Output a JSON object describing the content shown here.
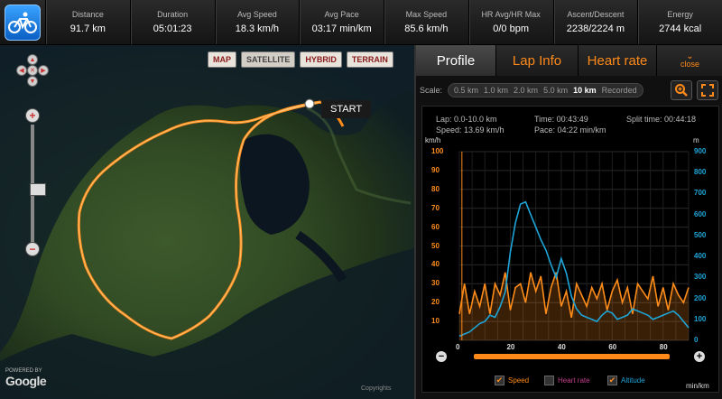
{
  "stats": [
    {
      "label": "Distance",
      "value": "91.7 km"
    },
    {
      "label": "Duration",
      "value": "05:01:23"
    },
    {
      "label": "Avg Speed",
      "value": "18.3 km/h"
    },
    {
      "label": "Avg Pace",
      "value": "03:17 min/km"
    },
    {
      "label": "Max Speed",
      "value": "85.6 km/h"
    },
    {
      "label": "HR Avg/HR Max",
      "value": "0/0 bpm"
    },
    {
      "label": "Ascent/Descent",
      "value": "2238/2224 m"
    },
    {
      "label": "Energy",
      "value": "2744 kcal"
    }
  ],
  "activity_icon": "bicycle-icon",
  "map": {
    "types": [
      "MAP",
      "SATELLITE",
      "HYBRID",
      "TERRAIN"
    ],
    "active_type": "SATELLITE",
    "start_label": "START",
    "powered_by": "POWERED BY",
    "google": "Google",
    "attribution": "Copyrights"
  },
  "tabs": {
    "profile": "Profile",
    "lap_info": "Lap Info",
    "heart_rate": "Heart rate",
    "close": "close"
  },
  "scale": {
    "label": "Scale:",
    "options": [
      "0.5 km",
      "1.0 km",
      "2.0 km",
      "5.0 km",
      "10 km",
      "Recorded"
    ],
    "selected": "10 km"
  },
  "lap": {
    "lap": "Lap: 0.0-10.0 km",
    "speed": "Speed: 13.69 km/h",
    "time": "Time: 00:43:49",
    "pace": "Pace: 04:22 min/km",
    "split": "Split time: 00:44:18"
  },
  "colors": {
    "speed": "#ff8c1a",
    "altitude": "#1ea5d8",
    "accent": "#ff8a1a"
  },
  "legend": {
    "speed": "Speed",
    "heart_rate": "Heart rate",
    "altitude": "Altitude"
  },
  "legend_checked": {
    "speed": true,
    "heart_rate": false,
    "altitude": true
  },
  "chart_data": {
    "type": "line",
    "left_unit": "km/h",
    "right_unit": "m",
    "x_unit": "min/km",
    "left_ylim": [
      0,
      100
    ],
    "right_ylim": [
      0,
      900
    ],
    "xlim": [
      0,
      90
    ],
    "left_ticks": [
      10,
      20,
      30,
      40,
      50,
      60,
      70,
      80,
      90,
      100
    ],
    "right_ticks": [
      0,
      100,
      200,
      300,
      400,
      500,
      600,
      700,
      800,
      900
    ],
    "x_ticks": [
      0,
      20,
      40,
      60,
      80
    ],
    "series": [
      {
        "name": "Speed",
        "axis": "left",
        "x": [
          0,
          2,
          4,
          6,
          8,
          10,
          12,
          14,
          16,
          18,
          20,
          22,
          24,
          26,
          28,
          30,
          32,
          34,
          36,
          38,
          40,
          42,
          44,
          46,
          48,
          50,
          52,
          54,
          56,
          58,
          60,
          62,
          64,
          66,
          68,
          70,
          72,
          74,
          76,
          78,
          80,
          82,
          84,
          86,
          88,
          90
        ],
        "values": [
          14,
          30,
          14,
          26,
          18,
          30,
          14,
          30,
          24,
          36,
          16,
          28,
          30,
          20,
          36,
          26,
          34,
          14,
          28,
          36,
          18,
          26,
          12,
          30,
          24,
          18,
          28,
          22,
          30,
          16,
          26,
          32,
          20,
          28,
          14,
          30,
          26,
          22,
          34,
          18,
          28,
          16,
          30,
          24,
          20,
          28
        ]
      },
      {
        "name": "Altitude",
        "axis": "right",
        "x": [
          0,
          2,
          4,
          6,
          8,
          10,
          12,
          14,
          16,
          18,
          20,
          22,
          24,
          26,
          28,
          30,
          32,
          34,
          36,
          38,
          40,
          42,
          44,
          46,
          48,
          50,
          52,
          54,
          56,
          58,
          60,
          62,
          64,
          66,
          68,
          70,
          72,
          74,
          76,
          78,
          80,
          82,
          84,
          86,
          88,
          90
        ],
        "values": [
          20,
          30,
          40,
          60,
          80,
          90,
          120,
          110,
          160,
          230,
          420,
          560,
          650,
          660,
          600,
          540,
          480,
          430,
          360,
          300,
          390,
          320,
          210,
          150,
          120,
          110,
          100,
          90,
          120,
          140,
          130,
          100,
          110,
          120,
          150,
          140,
          130,
          120,
          100,
          110,
          120,
          130,
          140,
          120,
          90,
          60
        ]
      }
    ]
  }
}
